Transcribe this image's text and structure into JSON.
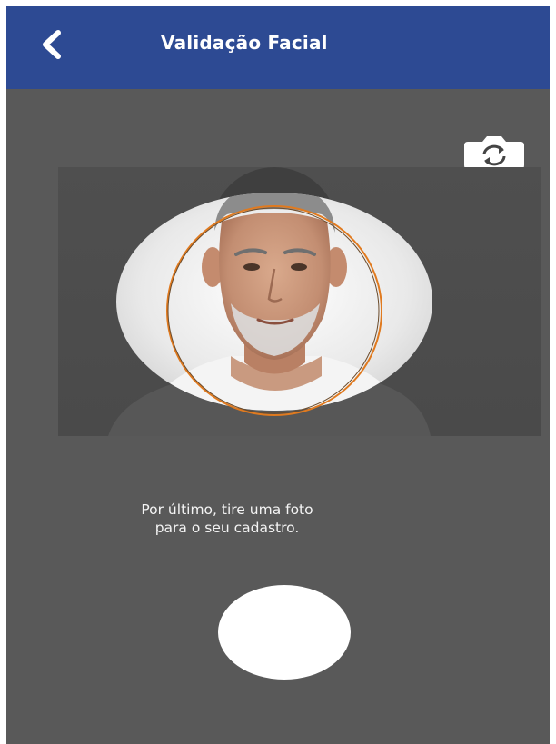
{
  "header": {
    "title": "Validação Facial",
    "back_icon": "chevron-left-icon",
    "background_color": "#2d4a93"
  },
  "camera": {
    "switch_icon": "camera-switch-icon",
    "guide_ring_color": "#e07a1f"
  },
  "instruction": {
    "line1": "Por último, tire uma foto",
    "line2": "para o seu cadastro."
  },
  "capture_button": {
    "icon": "shutter-button",
    "color": "#ffffff"
  },
  "theme": {
    "screen_background": "#595959",
    "text_color": "#f4f4f4"
  }
}
